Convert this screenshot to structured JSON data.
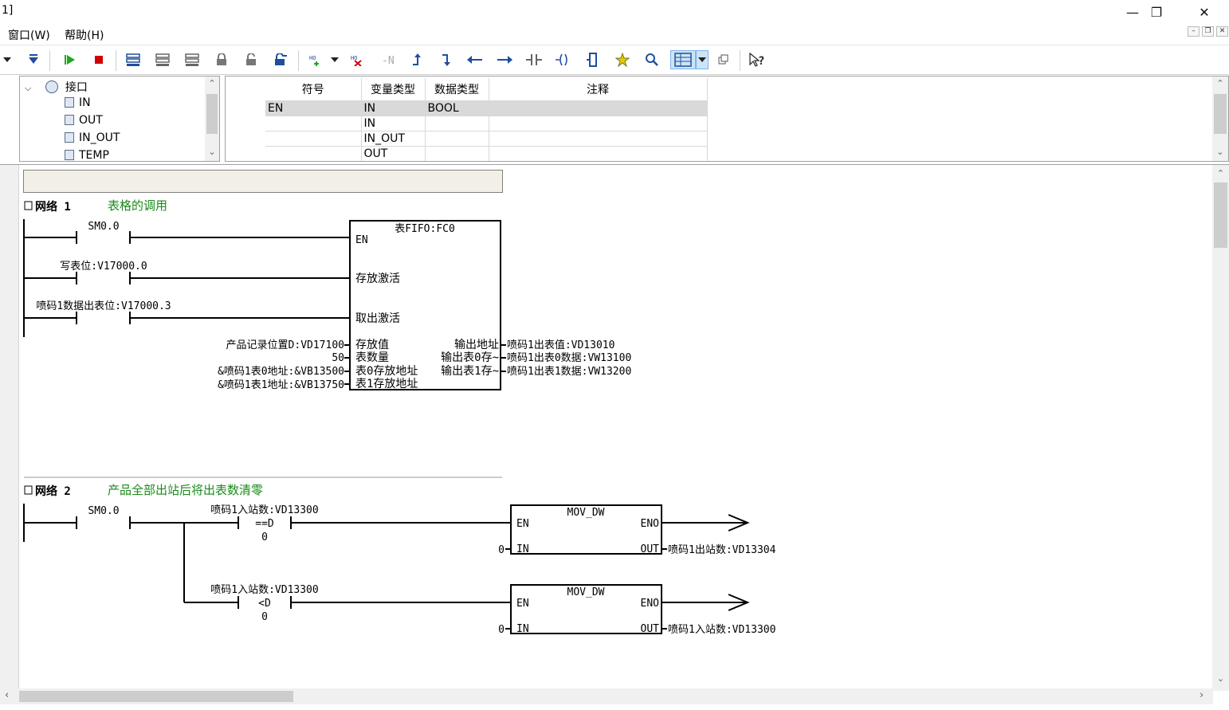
{
  "window": {
    "title": "1]",
    "min_icon": "minimize-icon",
    "max_icon": "restore-icon",
    "close_icon": "close-icon"
  },
  "menu": [
    {
      "label": "窗口(W)"
    },
    {
      "label": "帮助(H)"
    }
  ],
  "tree": {
    "root": "接口",
    "items": [
      "IN",
      "OUT",
      "IN_OUT",
      "TEMP"
    ]
  },
  "var_table": {
    "headers": [
      "符号",
      "变量类型",
      "数据类型",
      "注释"
    ],
    "rows": [
      {
        "symbol": "EN",
        "var_type": "IN",
        "data_type": "BOOL",
        "comment": ""
      },
      {
        "symbol": "",
        "var_type": "IN",
        "data_type": "",
        "comment": ""
      },
      {
        "symbol": "",
        "var_type": "IN_OUT",
        "data_type": "",
        "comment": ""
      },
      {
        "symbol": "",
        "var_type": "OUT",
        "data_type": "",
        "comment": ""
      }
    ]
  },
  "network1": {
    "label": "网络 1",
    "comment": "表格的调用",
    "contacts": [
      "SM0.0",
      "写表位:V17000.0",
      "喷码1数据出表位:V17000.3"
    ],
    "block": {
      "title": "表FIFO:FC0",
      "inputs": [
        "EN",
        "存放激活",
        "取出激活",
        "存放值",
        "表数量",
        "表0存放地址",
        "表1存放地址"
      ],
      "outputs": [
        "输出地址",
        "输出表0存~",
        "输出表1存~"
      ],
      "input_params": [
        "产品记录位置D:VD17100",
        "50",
        "&喷码1表0地址:&VB13500",
        "&喷码1表1地址:&VB13750"
      ],
      "output_params": [
        "喷码1出表值:VD13010",
        "喷码1出表0数据:VW13100",
        "喷码1出表1数据:VW13200"
      ]
    }
  },
  "network2": {
    "label": "网络 2",
    "comment": "产品全部出站后将出表数清零",
    "contact": "SM0.0",
    "compare1": {
      "operand": "喷码1入站数:VD13300",
      "op": "==D",
      "value": "0"
    },
    "compare2": {
      "operand": "喷码1入站数:VD13300",
      "op": "<D",
      "value": "0"
    },
    "block1": {
      "title": "MOV_DW",
      "en": "EN",
      "eno": "ENO",
      "in": "IN",
      "out": "OUT",
      "in_value": "0",
      "out_value": "喷码1出站数:VD13304"
    },
    "block2": {
      "title": "MOV_DW",
      "en": "EN",
      "eno": "ENO",
      "in": "IN",
      "out": "OUT",
      "in_value": "0",
      "out_value": "喷码1入站数:VD13300"
    }
  },
  "colors": {
    "comment_green": "#1a8a1a",
    "play_green": "#1fa81f",
    "stop_red": "#d00000",
    "tool_blue": "#1f4e9c"
  }
}
